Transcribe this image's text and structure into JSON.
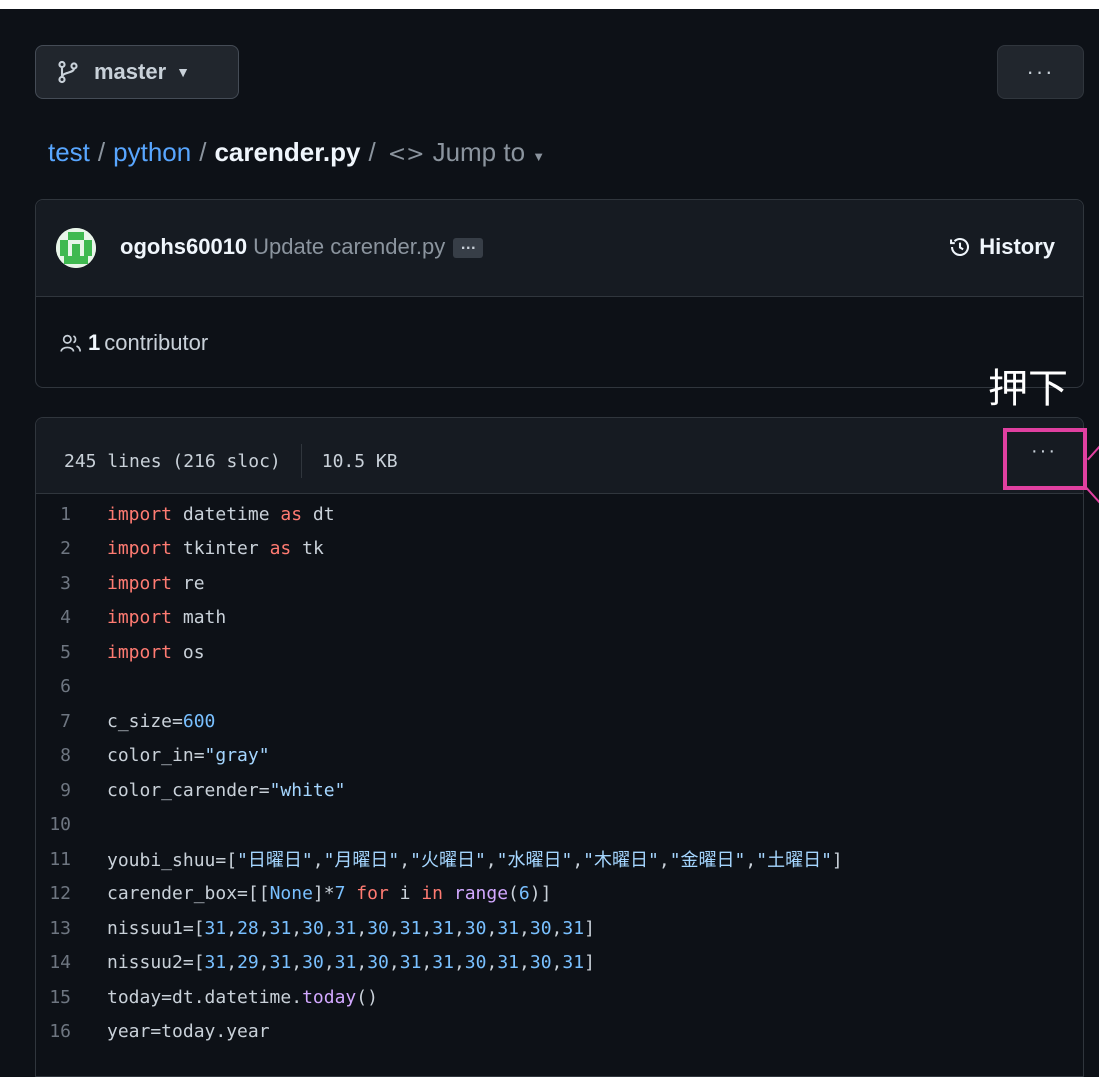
{
  "branch": {
    "name": "master"
  },
  "breadcrumb": {
    "repo": "test",
    "folder": "python",
    "file": "carender.py",
    "separator": "/",
    "jump_label": "Jump to"
  },
  "commit": {
    "author": "ogohs60010",
    "message": "Update carender.py",
    "ellipsis": "…",
    "history_label": "History"
  },
  "contributors": {
    "count": "1",
    "label": "contributor"
  },
  "annotation": {
    "text": "押下"
  },
  "file_info": {
    "lines": "245 lines (216 sloc)",
    "size": "10.5 KB"
  },
  "more_label": "···",
  "code_lines": [
    [
      [
        "kw",
        "import"
      ],
      [
        "t",
        " datetime "
      ],
      [
        "kw",
        "as"
      ],
      [
        "t",
        " dt"
      ]
    ],
    [
      [
        "kw",
        "import"
      ],
      [
        "t",
        " tkinter "
      ],
      [
        "kw",
        "as"
      ],
      [
        "t",
        " tk"
      ]
    ],
    [
      [
        "kw",
        "import"
      ],
      [
        "t",
        " re"
      ]
    ],
    [
      [
        "kw",
        "import"
      ],
      [
        "t",
        " math"
      ]
    ],
    [
      [
        "kw",
        "import"
      ],
      [
        "t",
        " os"
      ]
    ],
    [],
    [
      [
        "t",
        "c_size="
      ],
      [
        "num",
        "600"
      ]
    ],
    [
      [
        "t",
        "color_in="
      ],
      [
        "str",
        "\"gray\""
      ]
    ],
    [
      [
        "t",
        "color_carender="
      ],
      [
        "str",
        "\"white\""
      ]
    ],
    [],
    [
      [
        "t",
        "youbi_shuu=["
      ],
      [
        "str",
        "\"日曜日\""
      ],
      [
        "t",
        ","
      ],
      [
        "str",
        "\"月曜日\""
      ],
      [
        "t",
        ","
      ],
      [
        "str",
        "\"火曜日\""
      ],
      [
        "t",
        ","
      ],
      [
        "str",
        "\"水曜日\""
      ],
      [
        "t",
        ","
      ],
      [
        "str",
        "\"木曜日\""
      ],
      [
        "t",
        ","
      ],
      [
        "str",
        "\"金曜日\""
      ],
      [
        "t",
        ","
      ],
      [
        "str",
        "\"土曜日\""
      ],
      [
        "t",
        "]"
      ]
    ],
    [
      [
        "t",
        "carender_box=[["
      ],
      [
        "num",
        "None"
      ],
      [
        "t",
        "]*"
      ],
      [
        "num",
        "7"
      ],
      [
        "t",
        " "
      ],
      [
        "kw",
        "for"
      ],
      [
        "t",
        " i "
      ],
      [
        "kw",
        "in"
      ],
      [
        "t",
        " "
      ],
      [
        "fn",
        "range"
      ],
      [
        "t",
        "("
      ],
      [
        "num",
        "6"
      ],
      [
        "t",
        ")]"
      ]
    ],
    [
      [
        "t",
        "nissuu1=["
      ],
      [
        "num",
        "31"
      ],
      [
        "t",
        ","
      ],
      [
        "num",
        "28"
      ],
      [
        "t",
        ","
      ],
      [
        "num",
        "31"
      ],
      [
        "t",
        ","
      ],
      [
        "num",
        "30"
      ],
      [
        "t",
        ","
      ],
      [
        "num",
        "31"
      ],
      [
        "t",
        ","
      ],
      [
        "num",
        "30"
      ],
      [
        "t",
        ","
      ],
      [
        "num",
        "31"
      ],
      [
        "t",
        ","
      ],
      [
        "num",
        "31"
      ],
      [
        "t",
        ","
      ],
      [
        "num",
        "30"
      ],
      [
        "t",
        ","
      ],
      [
        "num",
        "31"
      ],
      [
        "t",
        ","
      ],
      [
        "num",
        "30"
      ],
      [
        "t",
        ","
      ],
      [
        "num",
        "31"
      ],
      [
        "t",
        "]"
      ]
    ],
    [
      [
        "t",
        "nissuu2=["
      ],
      [
        "num",
        "31"
      ],
      [
        "t",
        ","
      ],
      [
        "num",
        "29"
      ],
      [
        "t",
        ","
      ],
      [
        "num",
        "31"
      ],
      [
        "t",
        ","
      ],
      [
        "num",
        "30"
      ],
      [
        "t",
        ","
      ],
      [
        "num",
        "31"
      ],
      [
        "t",
        ","
      ],
      [
        "num",
        "30"
      ],
      [
        "t",
        ","
      ],
      [
        "num",
        "31"
      ],
      [
        "t",
        ","
      ],
      [
        "num",
        "31"
      ],
      [
        "t",
        ","
      ],
      [
        "num",
        "30"
      ],
      [
        "t",
        ","
      ],
      [
        "num",
        "31"
      ],
      [
        "t",
        ","
      ],
      [
        "num",
        "30"
      ],
      [
        "t",
        ","
      ],
      [
        "num",
        "31"
      ],
      [
        "t",
        "]"
      ]
    ],
    [
      [
        "t",
        "today=dt.datetime."
      ],
      [
        "fn",
        "today"
      ],
      [
        "t",
        "()"
      ]
    ],
    [
      [
        "t",
        "year=today.year"
      ]
    ]
  ],
  "colors": {
    "accent": "#58a6ff",
    "highlight": "#e040a0",
    "background": "#0d1117"
  }
}
